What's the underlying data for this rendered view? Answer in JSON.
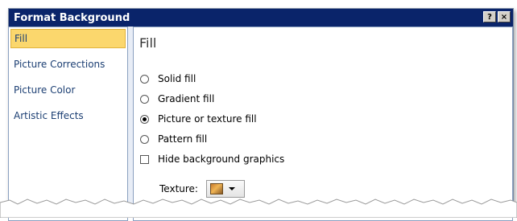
{
  "window": {
    "title": "Format Background",
    "help_label": "?",
    "close_label": "×"
  },
  "sidebar": {
    "items": [
      {
        "label": "Fill",
        "selected": true
      },
      {
        "label": "Picture Corrections",
        "selected": false
      },
      {
        "label": "Picture Color",
        "selected": false
      },
      {
        "label": "Artistic Effects",
        "selected": false
      }
    ]
  },
  "fill": {
    "heading": "Fill",
    "options": [
      {
        "label": "Solid fill",
        "checked": false
      },
      {
        "label": "Gradient fill",
        "checked": false
      },
      {
        "label": "Picture or texture fill",
        "checked": true
      },
      {
        "label": "Pattern fill",
        "checked": false
      }
    ],
    "hide_graphics": {
      "label": "Hide background graphics",
      "checked": false
    },
    "texture": {
      "label": "Texture:",
      "icon": "texture-swatch-icon"
    }
  },
  "colors": {
    "titlebar": "#0a246a",
    "selected_item": "#fbd76d",
    "nav_text": "#1c3f73"
  }
}
